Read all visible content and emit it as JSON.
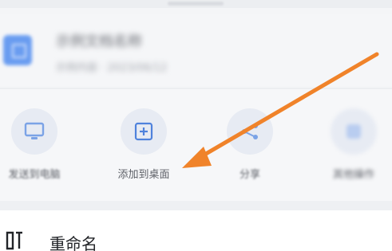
{
  "header": {
    "file_title": "示例文档名称",
    "file_meta": "示例内容 · 2023/06/12"
  },
  "actions": [
    {
      "label": "发送到电脑",
      "icon": "monitor-icon"
    },
    {
      "label": "添加到桌面",
      "icon": "add-square-icon"
    },
    {
      "label": "分享",
      "icon": "share-icon"
    },
    {
      "label": "其他操作",
      "icon": "app-icon"
    }
  ],
  "list": {
    "rename_label": "重命名",
    "rename_icon": "rename-icon"
  },
  "annotation": {
    "arrow_color": "#f0832a",
    "target": "add-to-desktop-button"
  },
  "colors": {
    "file_icon": "#5b93f0",
    "action_icon": "#4f82dc",
    "arrow": "#f0832a"
  }
}
